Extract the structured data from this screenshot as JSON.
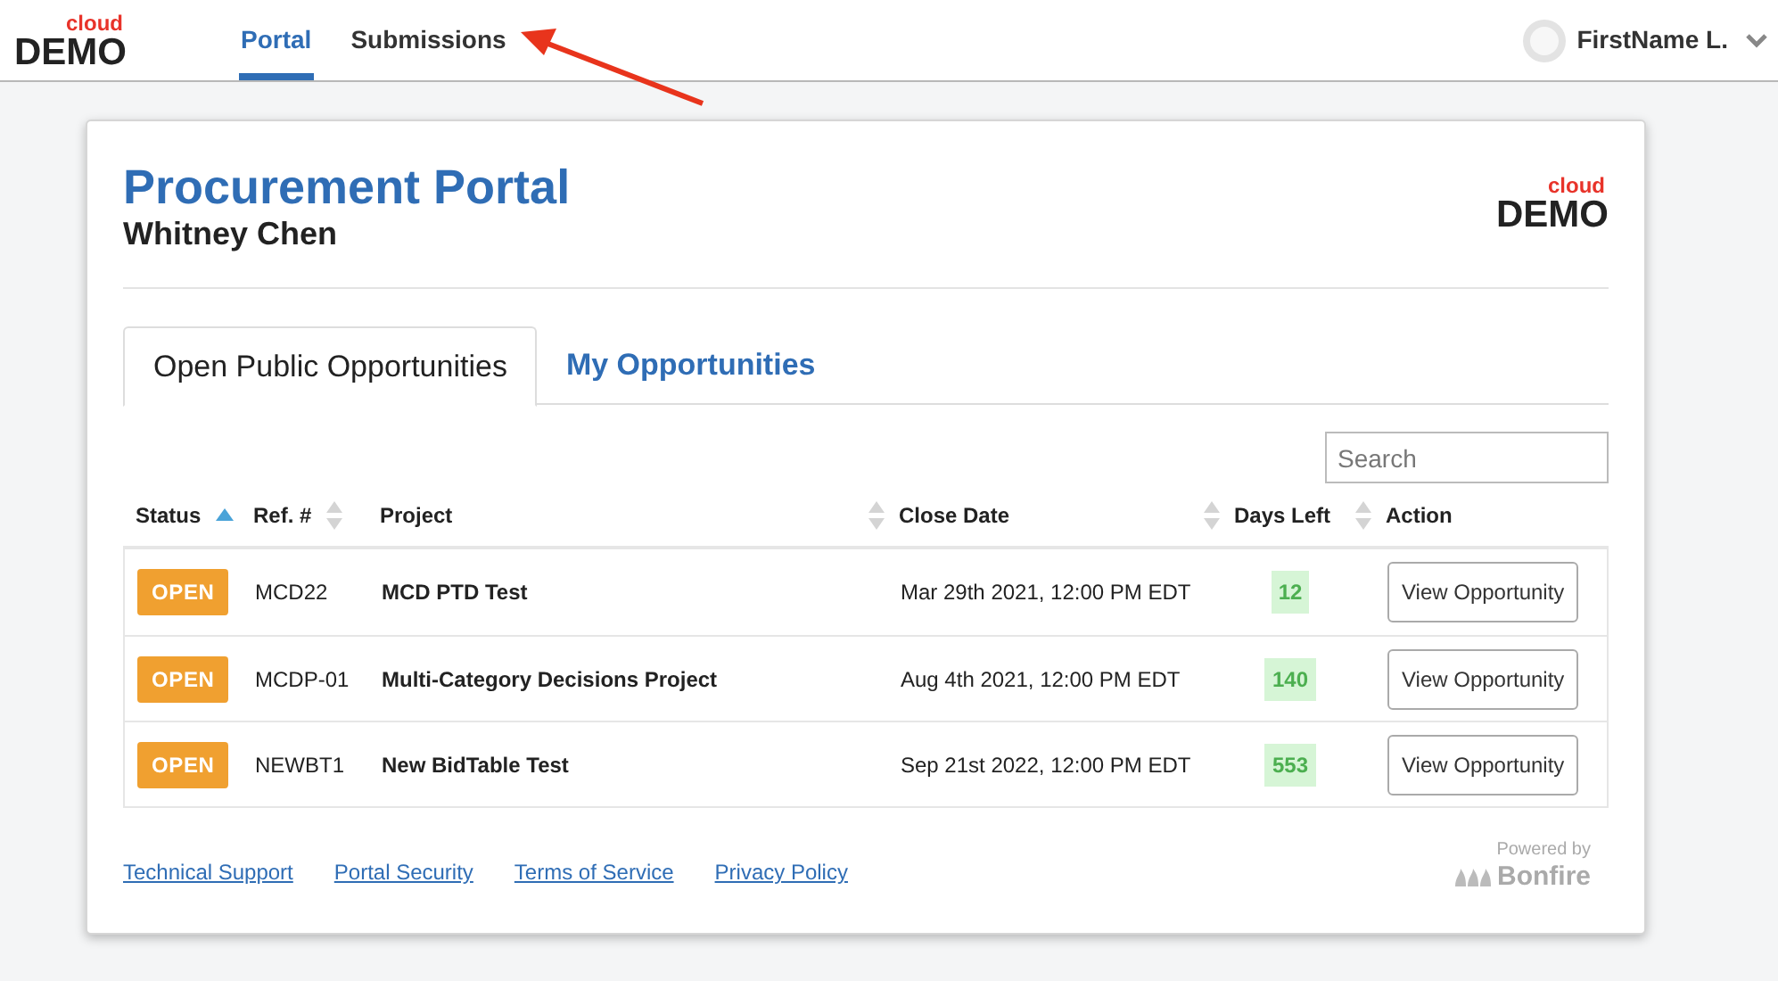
{
  "header": {
    "logo": {
      "top": "cloud",
      "bottom": "DEMO"
    },
    "nav": [
      {
        "label": "Portal",
        "selected": true
      },
      {
        "label": "Submissions",
        "selected": false
      }
    ],
    "user": {
      "name": "FirstName L."
    }
  },
  "portal": {
    "title": "Procurement Portal",
    "subtitle": "Whitney Chen",
    "logo": {
      "top": "cloud",
      "bottom": "DEMO"
    },
    "tabs": [
      {
        "label": "Open Public Opportunities",
        "selected": true
      },
      {
        "label": "My Opportunities",
        "selected": false
      }
    ],
    "search": {
      "placeholder": "Search"
    },
    "table": {
      "columns": [
        {
          "label": "Status",
          "sortable": true,
          "sorted": true
        },
        {
          "label": "Ref. #",
          "sortable": true,
          "sorted": false
        },
        {
          "label": "Project",
          "sortable": true,
          "sorted": false
        },
        {
          "label": "Close Date",
          "sortable": true,
          "sorted": false
        },
        {
          "label": "Days Left",
          "sortable": true,
          "sorted": false
        },
        {
          "label": "Action",
          "sortable": false
        }
      ],
      "rows": [
        {
          "status": "OPEN",
          "ref": "MCD22",
          "project": "MCD PTD Test",
          "close_date": "Mar 29th 2021, 12:00 PM EDT",
          "days_left": "12",
          "action": "View Opportunity"
        },
        {
          "status": "OPEN",
          "ref": "MCDP-01",
          "project": "Multi-Category Decisions Project",
          "close_date": "Aug 4th 2021, 12:00 PM EDT",
          "days_left": "140",
          "action": "View Opportunity"
        },
        {
          "status": "OPEN",
          "ref": "NEWBT1",
          "project": "New BidTable Test",
          "close_date": "Sep 21st 2022, 12:00 PM EDT",
          "days_left": "553",
          "action": "View Opportunity"
        }
      ]
    },
    "footer_links": [
      "Technical Support",
      "Portal Security",
      "Terms of Service",
      "Privacy Policy"
    ],
    "powered_by": {
      "caption": "Powered by",
      "brand": "Bonfire"
    }
  }
}
